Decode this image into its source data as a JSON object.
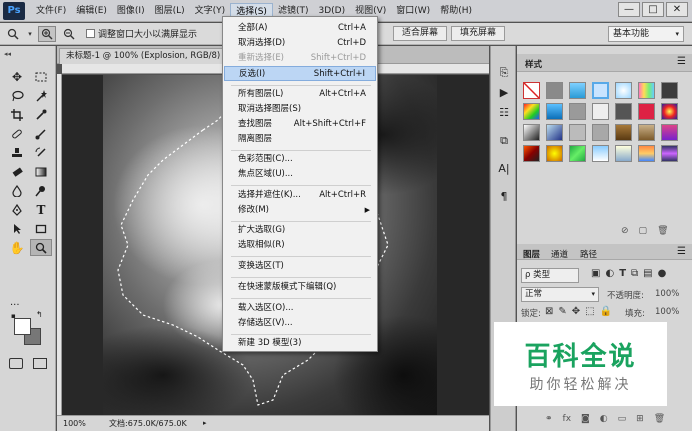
{
  "app": {
    "logo": "Ps"
  },
  "menubar": {
    "items": [
      "文件(F)",
      "编辑(E)",
      "图像(I)",
      "图层(L)",
      "文字(Y)",
      "选择(S)",
      "滤镜(T)",
      "3D(D)",
      "视图(V)",
      "窗口(W)",
      "帮助(H)"
    ]
  },
  "window": {
    "minimize": "—",
    "maximize": "□",
    "close": "✕"
  },
  "options": {
    "resize_windows_label": "调整窗口大小以满屏显示",
    "fit_screen": "适合屏幕",
    "fill_screen": "填充屏幕",
    "workspace": "基本功能"
  },
  "document": {
    "tab_title": "未标题-1 @ 100% (Explosion, RGB/8) *",
    "tab_close": "×",
    "zoom": "100%",
    "doc_info": "文档:675.0K/675.0K"
  },
  "select_menu": {
    "items": [
      {
        "label": "全部(A)",
        "shortcut": "Ctrl+A"
      },
      {
        "label": "取消选择(D)",
        "shortcut": "Ctrl+D"
      },
      {
        "label": "重新选择(E)",
        "shortcut": "Shift+Ctrl+D"
      },
      {
        "label": "反选(I)",
        "shortcut": "Shift+Ctrl+I"
      },
      {
        "label": "所有图层(L)",
        "shortcut": "Alt+Ctrl+A"
      },
      {
        "label": "取消选择图层(S)",
        "shortcut": ""
      },
      {
        "label": "查找图层",
        "shortcut": "Alt+Shift+Ctrl+F"
      },
      {
        "label": "隔离图层",
        "shortcut": ""
      },
      {
        "label": "色彩范围(C)...",
        "shortcut": ""
      },
      {
        "label": "焦点区域(U)...",
        "shortcut": ""
      },
      {
        "label": "选择并遮住(K)...",
        "shortcut": "Alt+Ctrl+R"
      },
      {
        "label": "修改(M)",
        "shortcut": ""
      },
      {
        "label": "扩大选取(G)",
        "shortcut": ""
      },
      {
        "label": "选取相似(R)",
        "shortcut": ""
      },
      {
        "label": "变换选区(T)",
        "shortcut": ""
      },
      {
        "label": "在快速蒙版模式下编辑(Q)",
        "shortcut": ""
      },
      {
        "label": "载入选区(O)...",
        "shortcut": ""
      },
      {
        "label": "存储选区(V)...",
        "shortcut": ""
      },
      {
        "label": "新建 3D 模型(3)",
        "shortcut": ""
      }
    ]
  },
  "styles_panel": {
    "tab": "样式"
  },
  "layers_panel": {
    "tabs": [
      "图层",
      "通道",
      "路径"
    ],
    "filter_type": "ρ 类型",
    "blend_mode": "正常",
    "opacity_label": "不透明度:",
    "opacity_value": "100%",
    "lock_label": "锁定:",
    "fill_label": "填充:",
    "fill_value": "100%"
  },
  "watermark": {
    "title": "百科全说",
    "subtitle": "助你轻松解决"
  }
}
